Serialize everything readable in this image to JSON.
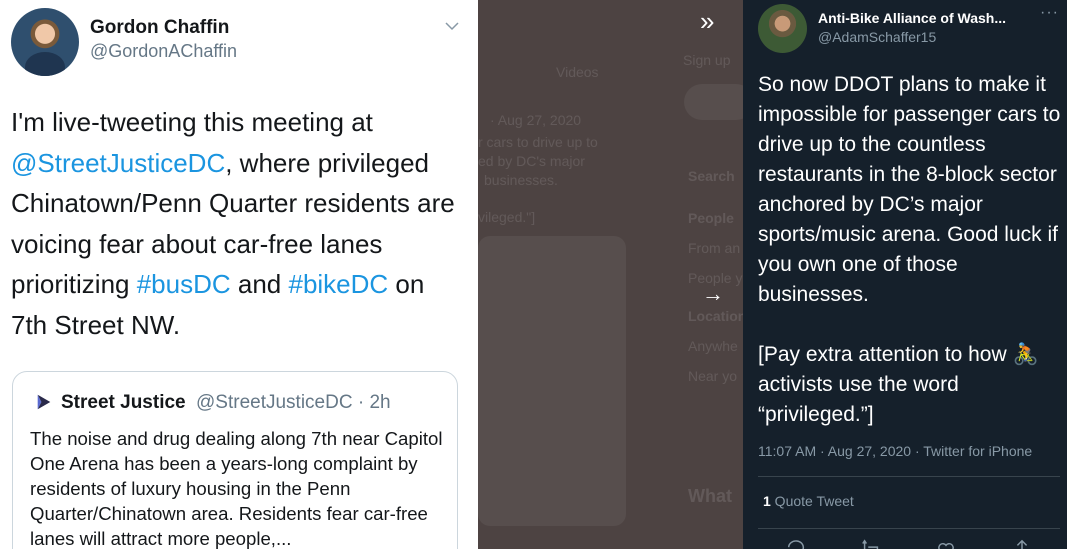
{
  "left_tweet": {
    "author_name": "Gordon Chaffin",
    "author_handle": "@GordonAChaffin",
    "text_parts": {
      "p1": "I'm live-tweeting this meeting at ",
      "mention": "@StreetJusticeDC",
      "p2": ", where privileged Chinatown/Penn Quarter residents are voicing fear about car-free lanes prioritizing ",
      "hashtag1": "#busDC",
      "p3": " and ",
      "hashtag2": "#bikeDC",
      "p4": " on 7th Street NW."
    },
    "quote": {
      "name": "Street Justice",
      "handle_time": "@StreetJusticeDC · 2h",
      "text": "The noise and drug dealing along 7th near Capitol One Arena has been a years-long complaint by residents of luxury housing in the Penn Quarter/Chinatown area. Residents fear car-free lanes will attract more people,..."
    }
  },
  "background": {
    "ghost_tabs": "Videos",
    "ghost_date": "· Aug 27, 2020",
    "ghost_text1": "r cars to drive up to",
    "ghost_text2": "ed by DC's major",
    "ghost_text3": "businesses.",
    "ghost_quote": "vileged.\"]",
    "ghost_search": "Search",
    "ghost_people": "People",
    "ghost_from": "From an",
    "ghost_people2": "People y",
    "ghost_location": "Location",
    "ghost_anywhere": "Anywhe",
    "ghost_near": "Near yo",
    "ghost_whats": "What",
    "ghost_signup": "Sign up"
  },
  "right_tweet": {
    "author_name": "Anti-Bike Alliance of Wash...",
    "author_handle": "@AdamSchaffer15",
    "more": "···",
    "text_main": "So now DDOT plans to make it impossible for passenger cars to drive up to the countless restaurants in the 8-block sector anchored by DC’s major sports/music arena. Good luck if you own one of those businesses.",
    "text_bracket_start": "[Pay extra attention to how ",
    "emoji": "🚴",
    "text_bracket_end": " activists use the word “privileged.”]",
    "timestamp": "11:07 AM · Aug 27, 2020 · Twitter for iPhone",
    "quote_count": "1",
    "quote_label": " Quote Tweet"
  },
  "colors": {
    "link": "#1b95e0",
    "dark_bg": "#15202b",
    "dim_bg": "#4d4342"
  }
}
